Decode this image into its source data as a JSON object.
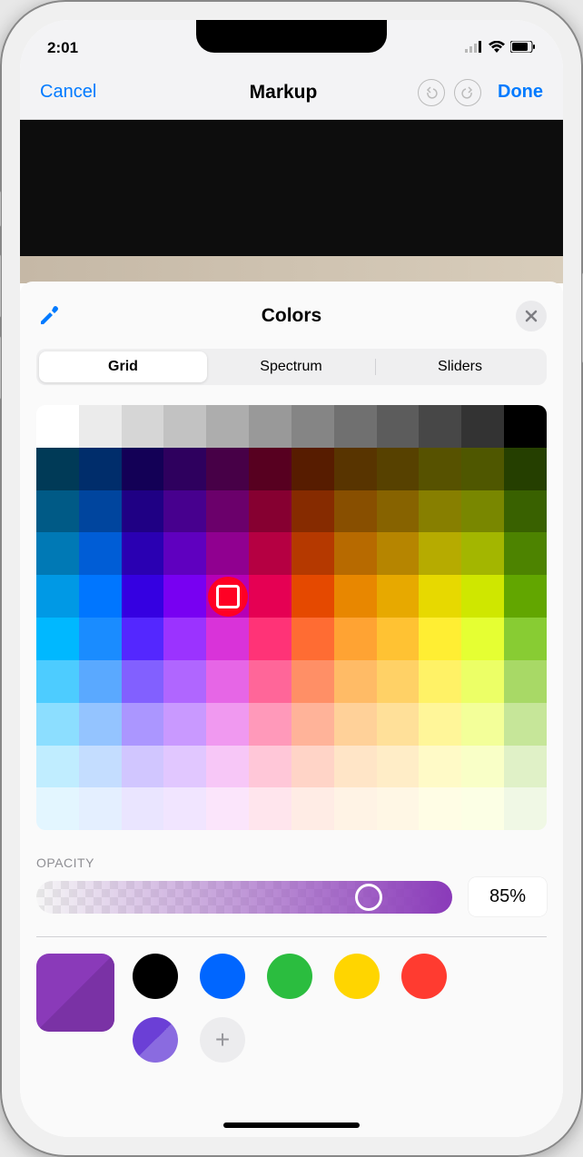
{
  "status": {
    "time": "2:01"
  },
  "nav": {
    "cancel": "Cancel",
    "title": "Markup",
    "done": "Done"
  },
  "sheet": {
    "title": "Colors",
    "tabs": [
      "Grid",
      "Spectrum",
      "Sliders"
    ],
    "active_tab": 0
  },
  "grid": {
    "cols": 12,
    "rows": 10,
    "selected": {
      "col": 4,
      "row": 4
    },
    "highlight_color": "#ff0024",
    "colors": [
      [
        "#ffffff",
        "#ebebeb",
        "#d6d6d6",
        "#c2c2c2",
        "#adadad",
        "#999999",
        "#858585",
        "#707070",
        "#5c5c5c",
        "#474747",
        "#333333",
        "#000000"
      ],
      [
        "#003a57",
        "#002d6b",
        "#130056",
        "#2e005e",
        "#470047",
        "#570020",
        "#571c00",
        "#583400",
        "#574100",
        "#575200",
        "#4f5700",
        "#253f00"
      ],
      [
        "#005a86",
        "#00459e",
        "#1f0084",
        "#47008e",
        "#6b006b",
        "#860031",
        "#862b00",
        "#884f00",
        "#876300",
        "#877f00",
        "#798700",
        "#396100"
      ],
      [
        "#0079b5",
        "#005dd6",
        "#2a00b2",
        "#5f00bf",
        "#900090",
        "#b50042",
        "#b53900",
        "#b76a00",
        "#b68500",
        "#b6ab00",
        "#a3b600",
        "#4d8300"
      ],
      [
        "#0099e5",
        "#0076ff",
        "#3500e1",
        "#7800f2",
        "#b600b6",
        "#e50053",
        "#e54900",
        "#e88700",
        "#e7a900",
        "#e7d900",
        "#cfe700",
        "#62a600"
      ],
      [
        "#00b8ff",
        "#1a8cff",
        "#5427ff",
        "#9b33ff",
        "#d933d9",
        "#ff3377",
        "#ff6c33",
        "#ffa333",
        "#ffc233",
        "#ffee33",
        "#e5ff33",
        "#88cc33"
      ],
      [
        "#4dccff",
        "#5aa9ff",
        "#8260ff",
        "#b066ff",
        "#e666e6",
        "#ff6699",
        "#ff8f66",
        "#ffbb66",
        "#ffd166",
        "#fff266",
        "#ecff66",
        "#a8d966"
      ],
      [
        "#8cdeff",
        "#94c4ff",
        "#ab96ff",
        "#c999ff",
        "#f099f0",
        "#ff99ba",
        "#ffb399",
        "#ffd199",
        "#ffe099",
        "#fff699",
        "#f3ff99",
        "#c6e699"
      ],
      [
        "#c0edff",
        "#c4ddff",
        "#d1c6ff",
        "#e1c7ff",
        "#f7c7f7",
        "#ffc7d8",
        "#ffd4c7",
        "#ffe5c7",
        "#ffedc7",
        "#fffac7",
        "#f9ffc7",
        "#e0f1c7"
      ],
      [
        "#e3f6ff",
        "#e4efff",
        "#eae5ff",
        "#f1e5ff",
        "#fbe5fb",
        "#ffe5ed",
        "#ffece5",
        "#fff3e5",
        "#fff7e5",
        "#fffde5",
        "#fcffe5",
        "#f0f8e5"
      ]
    ]
  },
  "opacity": {
    "label": "OPACITY",
    "value_text": "85%",
    "percent": 85,
    "thumb_pos_percent": 80,
    "color": "#8a3ab9"
  },
  "current_color": {
    "a": "#8a3ab9",
    "b": "#7a32a5"
  },
  "presets": [
    {
      "type": "color",
      "color": "#000000"
    },
    {
      "type": "color",
      "color": "#0066ff"
    },
    {
      "type": "color",
      "color": "#2bbd3f"
    },
    {
      "type": "color",
      "color": "#ffd500"
    },
    {
      "type": "color",
      "color": "#ff3b30"
    },
    {
      "type": "two-tone"
    },
    {
      "type": "add"
    }
  ]
}
